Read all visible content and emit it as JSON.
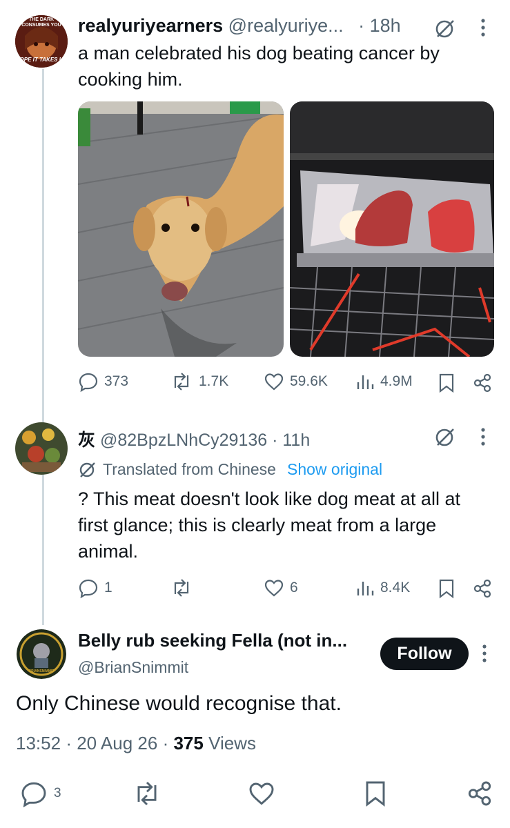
{
  "thread": {
    "tweet1": {
      "display_name": "realyuriyearners",
      "handle": "@realyuriye...",
      "time": "· 18h",
      "text": "a man celebrated his dog beating cancer by cooking him.",
      "avatar_text_top": "THE DARK CONSUMES YOU",
      "avatar_text_bottom": "OPE IT TAKES U",
      "stats": {
        "replies": "373",
        "reposts": "1.7K",
        "likes": "59.6K",
        "views": "4.9M"
      }
    },
    "tweet2": {
      "display_name": "灰",
      "handle": "@82BpzLNhCy29136 · 11h",
      "translated_label": "Translated from Chinese",
      "show_original": "Show original",
      "text": "? This meat doesn't look like dog meat at all at first glance; this is clearly meat from a large animal.",
      "stats": {
        "replies": "1",
        "reposts": "",
        "likes": "6",
        "views": "8.4K"
      }
    },
    "main": {
      "display_name": "Belly rub seeking Fella (not in...",
      "handle": "@BrianSnimmit",
      "follow_label": "Follow",
      "avatar_text": "BRIANSNIMMIT",
      "text": "Only Chinese would recognise that.",
      "time": "13:52",
      "date": "20 Aug 26",
      "views_count": "375",
      "views_label": "Views",
      "stats": {
        "replies": "3"
      }
    }
  },
  "colors": {
    "accent": "#1d9bf0",
    "muted": "#536471",
    "text": "#0f1419",
    "thread_line": "#cfd9de"
  },
  "icons": [
    "grok-icon",
    "more-icon",
    "reply-icon",
    "repost-icon",
    "like-icon",
    "views-icon",
    "bookmark-icon",
    "share-icon",
    "translate-icon"
  ]
}
